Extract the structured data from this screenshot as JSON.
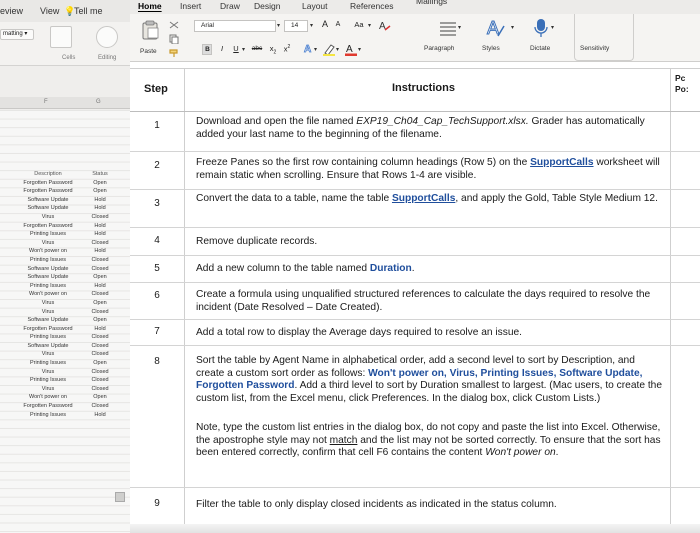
{
  "background_window": {
    "menu": {
      "review": "eview",
      "view": "View",
      "tell_me": "Tell me"
    },
    "ribbon": {
      "formatting": "matting",
      "cells_label": "Cells",
      "editing_label": "Editing"
    },
    "columns": [
      "F",
      "G"
    ],
    "description_header": "Description",
    "status_header": "Status",
    "descriptions": [
      "Forgotten Password",
      "Forgotten Password",
      "Software Update",
      "Software Update",
      "Virus",
      "Forgotten Password",
      "Printing Issues",
      "Virus",
      "Won't power on",
      "Printing Issues",
      "Software Update",
      "Software Update",
      "Printing Issues",
      "Won't power on",
      "Virus",
      "Virus",
      "Software Update",
      "Forgotten Password",
      "Printing Issues",
      "Software Update",
      "Virus",
      "Printing Issues",
      "Virus",
      "Printing Issues",
      "Virus",
      "Won't power on",
      "Forgotten Password",
      "Printing Issues"
    ],
    "statuses": [
      "Open",
      "Open",
      "Hold",
      "Hold",
      "Closed",
      "Hold",
      "Hold",
      "Closed",
      "Hold",
      "Closed",
      "Closed",
      "Open",
      "Hold",
      "Closed",
      "Open",
      "Closed",
      "Open",
      "Hold",
      "Closed",
      "Closed",
      "Closed",
      "Open",
      "Closed",
      "Closed",
      "Closed",
      "Open",
      "Closed",
      "Hold"
    ]
  },
  "ribbon": {
    "tabs": [
      "Home",
      "Insert",
      "Draw",
      "Design",
      "Layout",
      "References",
      "Mailings"
    ],
    "font_name": "Arial",
    "font_size": "14",
    "grow_font": "A",
    "shrink_font": "A",
    "change_case": "Aa",
    "bold": "B",
    "italic": "I",
    "underline": "U",
    "strikethrough": "abc",
    "subscript": "x",
    "superscript": "x",
    "paste_label": "Paste",
    "paragraph_label": "Paragraph",
    "styles_label": "Styles",
    "dictate_label": "Dictate",
    "sensitivity_label": "Sensitivity"
  },
  "table": {
    "header_step": "Step",
    "header_instructions": "Instructions",
    "header_points_1": "Pc",
    "header_points_2": "Po:",
    "rows": [
      {
        "step": "1",
        "t1": "Download and open the file named ",
        "t1i": "EXP19_Ch04_Cap_TechSupport.xlsx.",
        "t1b": " Grader has automatically added your last name to the beginning of the filename."
      },
      {
        "step": "2",
        "t1": "Freeze Panes so the first row containing column headings (Row 5) on the ",
        "t1b": "SupportCalls",
        "t1c": " worksheet will remain static when scrolling. Ensure that Rows 1-4 are visible."
      },
      {
        "step": "3",
        "t1": "Convert the data to a table, name the table ",
        "t1b": "SupportCalls",
        "t1c": ", and apply the Gold, Table Style Medium 12."
      },
      {
        "step": "4",
        "t1": "Remove duplicate records."
      },
      {
        "step": "5",
        "t1": "Add a new column to the table named ",
        "t1b": "Duration",
        "t1c": "."
      },
      {
        "step": "6",
        "t1": "Create a formula using unqualified structured references to calculate the days required to resolve the incident (Date Resolved – Date Created)."
      },
      {
        "step": "7",
        "t1": "Add a total row to display the Average days required to resolve an issue."
      },
      {
        "step": "8",
        "p1a": "Sort the table by Agent Name in alphabetical order, add a second level to sort by Description, and create a custom sort order as follows: ",
        "p1b": "Won't power on, Virus, Printing Issues, Software Update, Forgotten Password",
        "p1c": ". Add a third level to sort by Duration smallest to largest. (Mac users, to create the custom list, from the Excel menu, click Preferences. In the dialog box, click Custom Lists.)",
        "p2a": "Note, type the custom list entries in the dialog box, do not copy and paste the list into Excel. Otherwise, the apostrophe style may not ",
        "p2u": "match",
        "p2b": " and the list may not be sorted correctly. To ensure that the sort has been entered correctly, confirm that cell F6 contains the content ",
        "p2i": "Won't power on",
        "p2c": "."
      },
      {
        "step": "9",
        "t1": "Filter the table to only display closed incidents as indicated in the status column."
      }
    ]
  }
}
